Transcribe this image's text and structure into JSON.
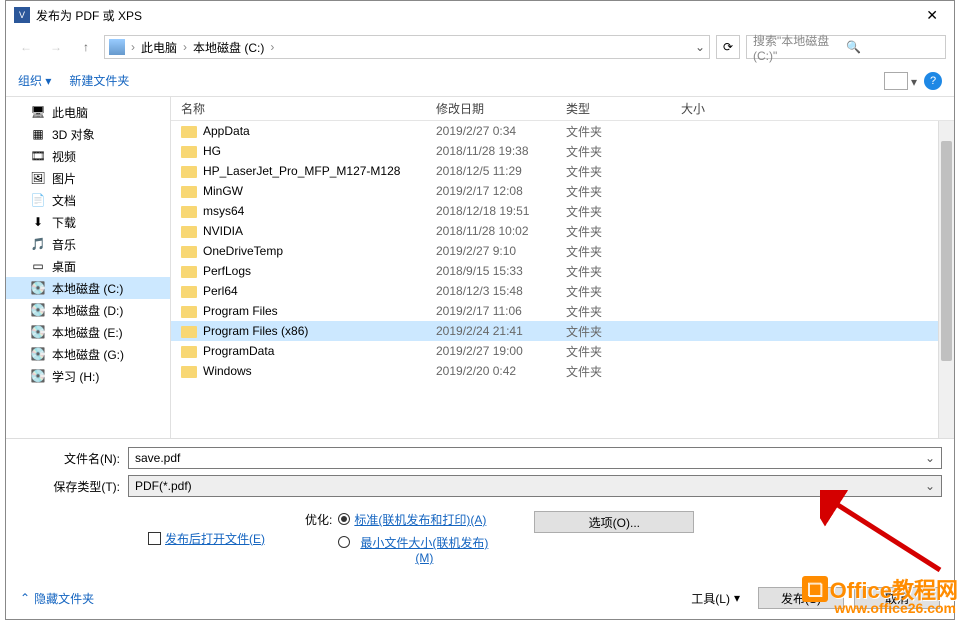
{
  "window": {
    "title": "发布为 PDF 或 XPS"
  },
  "breadcrumb": {
    "seg1": "此电脑",
    "seg2": "本地磁盘 (C:)"
  },
  "search": {
    "placeholder": "搜索\"本地磁盘 (C:)\""
  },
  "toolbar": {
    "organize": "组织",
    "newfolder": "新建文件夹"
  },
  "columns": {
    "name": "名称",
    "date": "修改日期",
    "type": "类型",
    "size": "大小"
  },
  "sidebar": [
    {
      "label": "此电脑",
      "icon": "pc"
    },
    {
      "label": "3D 对象",
      "icon": "3d"
    },
    {
      "label": "视频",
      "icon": "video"
    },
    {
      "label": "图片",
      "icon": "pic"
    },
    {
      "label": "文档",
      "icon": "doc"
    },
    {
      "label": "下载",
      "icon": "dl"
    },
    {
      "label": "音乐",
      "icon": "music"
    },
    {
      "label": "桌面",
      "icon": "desk"
    },
    {
      "label": "本地磁盘 (C:)",
      "icon": "disk",
      "selected": true
    },
    {
      "label": "本地磁盘 (D:)",
      "icon": "disk"
    },
    {
      "label": "本地磁盘 (E:)",
      "icon": "disk"
    },
    {
      "label": "本地磁盘 (G:)",
      "icon": "disk"
    },
    {
      "label": "学习 (H:)",
      "icon": "disk"
    }
  ],
  "files": [
    {
      "name": "AppData",
      "date": "2019/2/27 0:34",
      "type": "文件夹"
    },
    {
      "name": "HG",
      "date": "2018/11/28 19:38",
      "type": "文件夹"
    },
    {
      "name": "HP_LaserJet_Pro_MFP_M127-M128",
      "date": "2018/12/5 11:29",
      "type": "文件夹"
    },
    {
      "name": "MinGW",
      "date": "2019/2/17 12:08",
      "type": "文件夹"
    },
    {
      "name": "msys64",
      "date": "2018/12/18 19:51",
      "type": "文件夹"
    },
    {
      "name": "NVIDIA",
      "date": "2018/11/28 10:02",
      "type": "文件夹"
    },
    {
      "name": "OneDriveTemp",
      "date": "2019/2/27 9:10",
      "type": "文件夹"
    },
    {
      "name": "PerfLogs",
      "date": "2018/9/15 15:33",
      "type": "文件夹"
    },
    {
      "name": "Perl64",
      "date": "2018/12/3 15:48",
      "type": "文件夹"
    },
    {
      "name": "Program Files",
      "date": "2019/2/17 11:06",
      "type": "文件夹"
    },
    {
      "name": "Program Files (x86)",
      "date": "2019/2/24 21:41",
      "type": "文件夹",
      "selected": true
    },
    {
      "name": "ProgramData",
      "date": "2019/2/27 19:00",
      "type": "文件夹"
    },
    {
      "name": "Windows",
      "date": "2019/2/20 0:42",
      "type": "文件夹"
    }
  ],
  "form": {
    "filename_label": "文件名(N):",
    "filename_value": "save.pdf",
    "type_label": "保存类型(T):",
    "type_value": "PDF(*.pdf)",
    "open_after": "发布后打开文件(E)",
    "optimize_label": "优化:",
    "opt_standard": "标准(联机发布和打印)(A)",
    "opt_min": "最小文件大小(联机发布)(M)",
    "options_btn": "选项(O)..."
  },
  "footer": {
    "hide_folders": "隐藏文件夹",
    "tools": "工具(L)",
    "publish": "发布(S)",
    "cancel": "取消"
  },
  "watermark": {
    "brand": "Office教程网",
    "url": "www.office26.com"
  }
}
